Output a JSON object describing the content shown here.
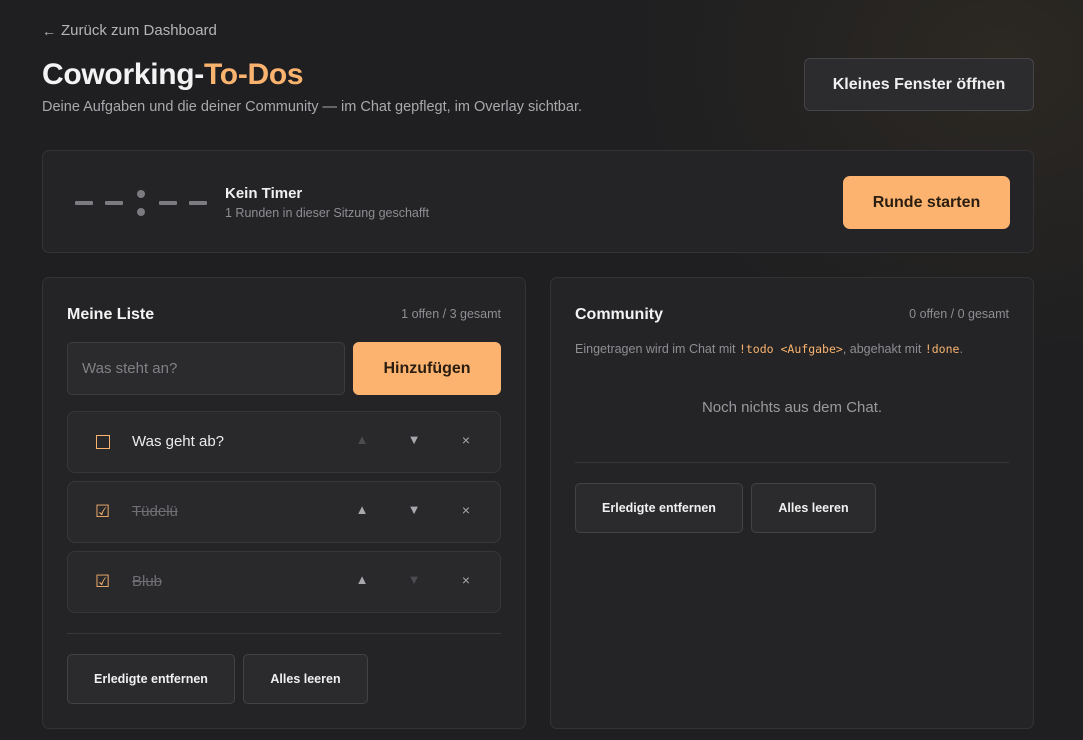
{
  "nav": {
    "back_label": "Zurück zum Dashboard"
  },
  "header": {
    "title_main": "Coworking-",
    "title_accent": "To-Dos",
    "subtitle": "Deine Aufgaben und die deiner Community — im Chat gepflegt, im Overlay sichtbar.",
    "window_button": "Kleines Fenster öffnen"
  },
  "timer": {
    "display": "--:--",
    "status": "Kein Timer",
    "rounds": "1 Runden in dieser Sitzung geschafft",
    "start_button": "Runde starten"
  },
  "my_list": {
    "title": "Meine Liste",
    "count": "1 offen / 3 gesamt",
    "input_placeholder": "Was steht an?",
    "add_button": "Hinzufügen",
    "items": [
      {
        "label": "Was geht ab?",
        "done": false,
        "check": "☐"
      },
      {
        "label": "Tüdelü",
        "done": true,
        "check": "☑"
      },
      {
        "label": "Blub",
        "done": true,
        "check": "☑"
      }
    ],
    "controls": {
      "up": "▲",
      "down": "▼",
      "delete": "×"
    },
    "clear_done_button": "Erledigte entfernen",
    "clear_all_button": "Alles leeren"
  },
  "community": {
    "title": "Community",
    "count": "0 offen / 0 gesamt",
    "hint_prefix": "Eingetragen wird im Chat mit ",
    "hint_cmd_add": "!todo <Aufgabe>",
    "hint_middle": ", abgehakt mit ",
    "hint_cmd_done": "!done",
    "hint_suffix": ".",
    "empty_message": "Noch nichts aus dem Chat.",
    "clear_done_button": "Erledigte entfernen",
    "clear_all_button": "Alles leeren"
  },
  "colors": {
    "accent": "#fbb36f",
    "background": "#1f1f21",
    "card": "#242426"
  }
}
